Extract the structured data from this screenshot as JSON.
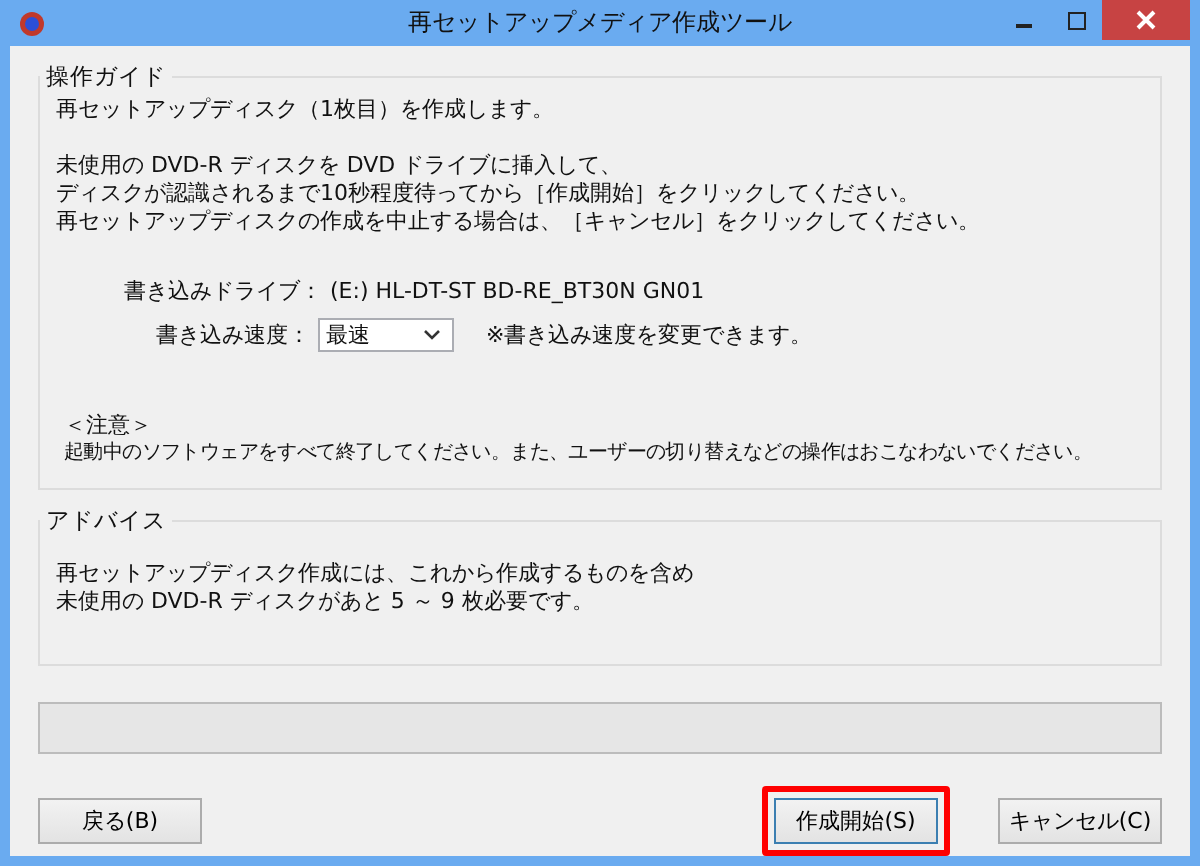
{
  "window": {
    "title": "再セットアップメディア作成ツール"
  },
  "guide": {
    "title": "操作ガイド",
    "lines": [
      "再セットアップディスク（1枚目）を作成します。"
    ],
    "instructions": [
      "未使用の DVD-R ディスクを DVD ドライブに挿入して、",
      "ディスクが認識されるまで10秒程度待ってから［作成開始］をクリックしてください。",
      "再セットアップディスクの作成を中止する場合は、［キャンセル］をクリックしてください。"
    ],
    "drive_label": "書き込みドライブ：",
    "drive_value": "(E:) HL-DT-ST BD-RE_BT30N GN01",
    "speed_label": "書き込み速度：",
    "speed_value": "最速",
    "speed_note": "※書き込み速度を変更できます。",
    "notice_title": "＜注意＞",
    "notice_text": "起動中のソフトウェアをすべて終了してください。また、ユーザーの切り替えなどの操作はおこなわないでください。"
  },
  "advice": {
    "title": "アドバイス",
    "lines": [
      "再セットアップディスク作成には、これから作成するものを含め",
      "未使用の DVD-R ディスクがあと 5 ～ 9 枚必要です。"
    ]
  },
  "progress": {
    "level": 0
  },
  "buttons": [
    {
      "label": "戻る(B)",
      "highlighted": false
    },
    {
      "label": "作成開始(S)",
      "highlighted": true
    },
    {
      "label": "キャンセル(C)",
      "highlighted": false
    }
  ]
}
